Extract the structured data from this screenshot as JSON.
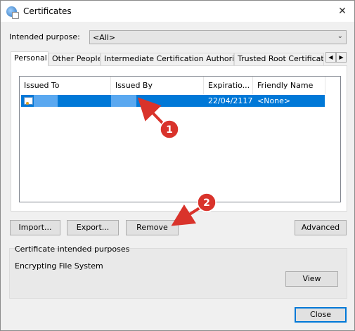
{
  "window": {
    "title": "Certificates",
    "close_glyph": "✕"
  },
  "intended_purpose": {
    "label": "Intended purpose:",
    "value": "<All>"
  },
  "tabs": [
    {
      "label": "Personal"
    },
    {
      "label": "Other People"
    },
    {
      "label": "Intermediate Certification Authorities"
    },
    {
      "label": "Trusted Root Certification"
    }
  ],
  "tab_scroll": {
    "left": "◀",
    "right": "▶"
  },
  "columns": {
    "issued_to": "Issued To",
    "issued_by": "Issued By",
    "expiration": "Expiratio...",
    "friendly_name": "Friendly Name"
  },
  "rows": [
    {
      "issued_to": "",
      "issued_by": "",
      "expiration": "22/04/2117",
      "friendly_name": "<None>",
      "selected": true
    }
  ],
  "buttons": {
    "import": "Import...",
    "export": "Export...",
    "remove": "Remove",
    "advanced": "Advanced",
    "view": "View",
    "close": "Close"
  },
  "purposes_group": {
    "title": "Certificate intended purposes",
    "text": "Encrypting File System"
  },
  "annotations": [
    {
      "number": "1"
    },
    {
      "number": "2"
    }
  ],
  "colors": {
    "selection": "#0078d7",
    "annotation_red": "#d9332b",
    "redaction_blue": "#5aa8f0"
  }
}
